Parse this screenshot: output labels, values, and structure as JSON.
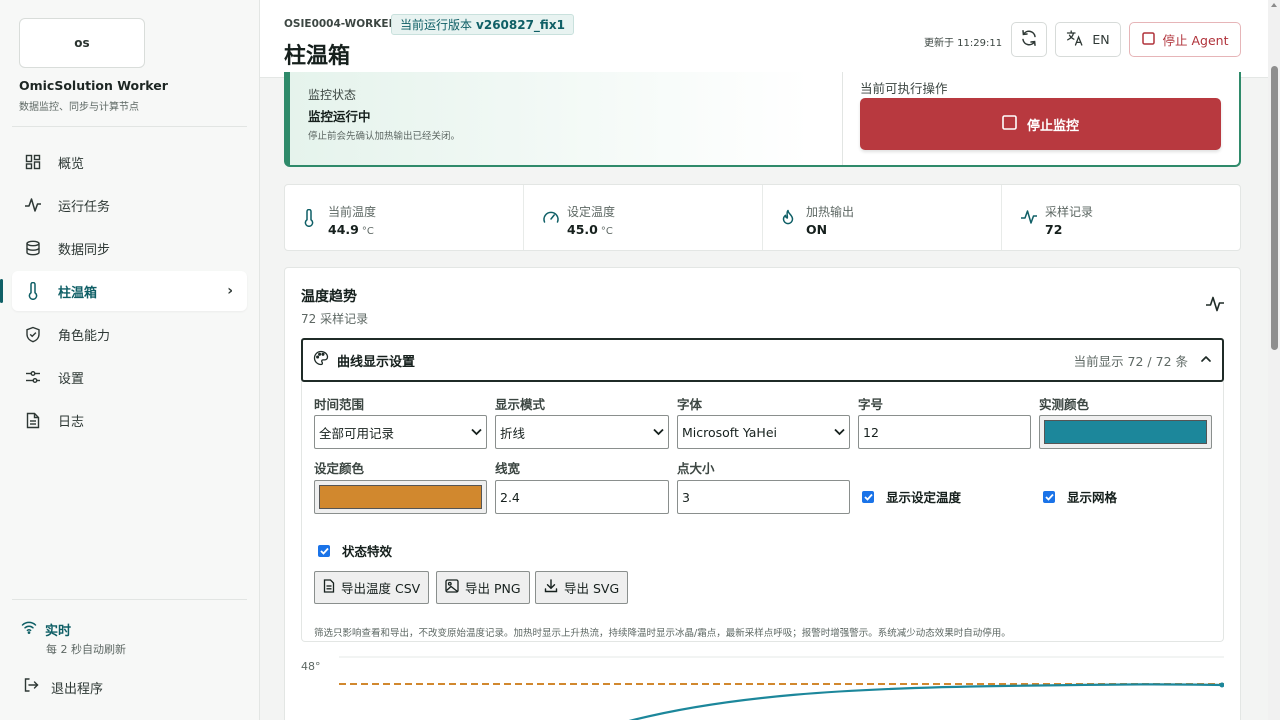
{
  "sidebar": {
    "logo": "os",
    "app_name": "OmicSolution Worker",
    "app_sub": "数据监控、同步与计算节点",
    "items": [
      {
        "label": "概览",
        "icon": "grid-icon"
      },
      {
        "label": "运行任务",
        "icon": "activity-icon"
      },
      {
        "label": "数据同步",
        "icon": "database-icon"
      },
      {
        "label": "柱温箱",
        "icon": "thermometer-icon",
        "active": true
      },
      {
        "label": "角色能力",
        "icon": "shield-icon"
      },
      {
        "label": "设置",
        "icon": "sliders-icon"
      },
      {
        "label": "日志",
        "icon": "file-icon"
      }
    ],
    "live_title": "实时",
    "live_sub": "每 2 秒自动刷新",
    "exit_label": "退出程序"
  },
  "header": {
    "worker_id": "OSIE0004-WORKER",
    "version_prefix": "当前运行版本",
    "version": "v260827_fix1",
    "title": "柱温箱",
    "updated": "更新于 11:29:11",
    "lang_label": "EN",
    "stop_agent_label": "停止 Agent"
  },
  "status": {
    "label": "监控状态",
    "value": "监控运行中",
    "note": "停止前会先确认加热输出已经关闭。",
    "op_label": "当前可执行操作",
    "op_button": "停止监控"
  },
  "metrics": [
    {
      "label": "当前温度",
      "value": "44.9",
      "unit": "°C",
      "icon": "thermometer-icon"
    },
    {
      "label": "设定温度",
      "value": "45.0",
      "unit": "°C",
      "icon": "gauge-icon"
    },
    {
      "label": "加热输出",
      "value": "ON",
      "unit": "",
      "icon": "flame-icon"
    },
    {
      "label": "采样记录",
      "value": "72",
      "unit": "",
      "icon": "activity-icon"
    }
  ],
  "trend": {
    "title": "温度趋势",
    "subtitle": "72 采样记录",
    "settings_title": "曲线显示设置",
    "settings_count": "当前显示 72 / 72 条",
    "fields": {
      "time_range_label": "时间范围",
      "time_range_value": "全部可用记录",
      "mode_label": "显示模式",
      "mode_value": "折线",
      "font_label": "字体",
      "font_value": "Microsoft YaHei",
      "font_size_label": "字号",
      "font_size_value": "12",
      "measured_color_label": "实测颜色",
      "measured_color": "#1c879b",
      "setpoint_color_label": "设定颜色",
      "setpoint_color": "#d1882e",
      "line_width_label": "线宽",
      "line_width_value": "2.4",
      "point_size_label": "点大小",
      "point_size_value": "3"
    },
    "checks": {
      "show_setpoint": "显示设定温度",
      "show_grid": "显示网格",
      "status_effects": "状态特效"
    },
    "exports": {
      "csv": "导出温度 CSV",
      "png": "导出 PNG",
      "svg": "导出 SVG"
    },
    "hint": "筛选只影响查看和导出，不改变原始温度记录。加热时显示上升热流，持续降温时显示冰晶/霜点，最新采样点呼吸；报警时增强警示。系统减少动态效果时自动停用。",
    "y_tick_top": "48°"
  },
  "colors": {
    "accent": "#0f5f66",
    "status_green": "#2f8a6a",
    "danger": "#b8393f"
  }
}
